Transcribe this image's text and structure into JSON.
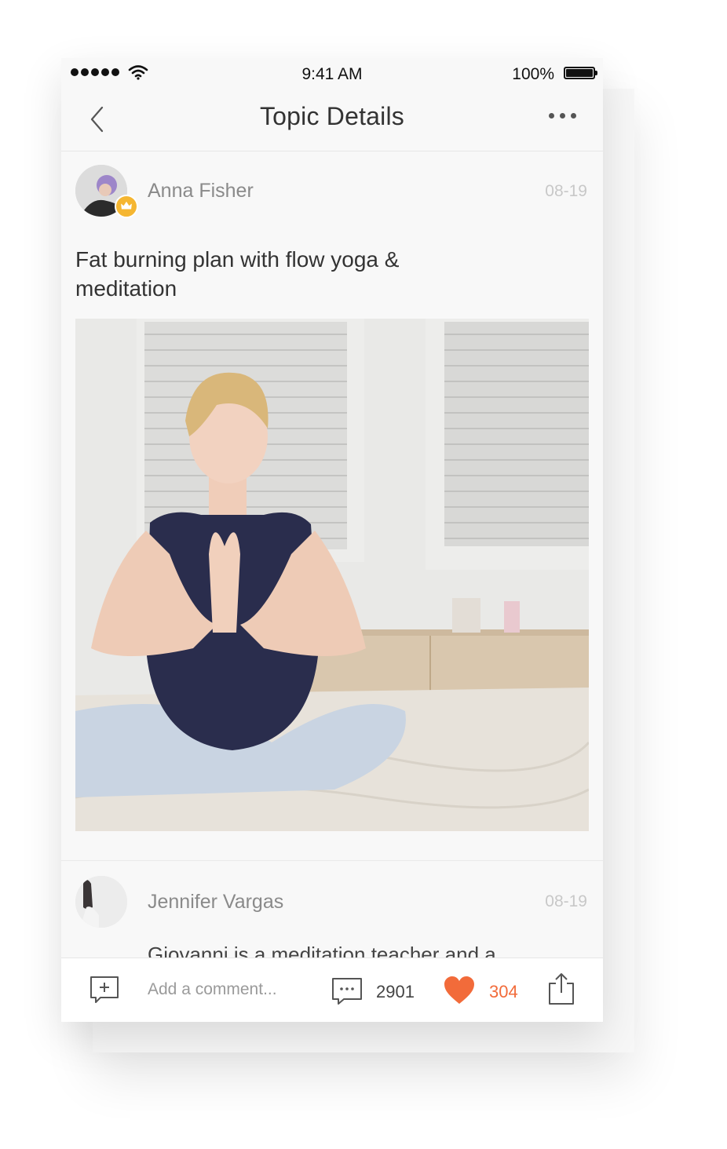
{
  "status_bar": {
    "time": "9:41 AM",
    "battery": "100%"
  },
  "nav": {
    "title": "Topic Details"
  },
  "post": {
    "author": "Anna Fisher",
    "date": "08-19",
    "title": "Fat burning plan with flow yoga & meditation"
  },
  "comment": {
    "author": "Jennifer Vargas",
    "date": "08-19",
    "text": "Giovanni is a meditation teacher and a"
  },
  "bottom_bar": {
    "placeholder": "Add a comment...",
    "comment_count": "2901",
    "like_count": "304"
  },
  "colors": {
    "accent": "#f26b3a",
    "crown": "#f5b631"
  },
  "icons": [
    "back-chevron-icon",
    "more-dots-icon",
    "crown-icon",
    "add-comment-icon",
    "comment-icon",
    "heart-icon",
    "share-icon"
  ]
}
